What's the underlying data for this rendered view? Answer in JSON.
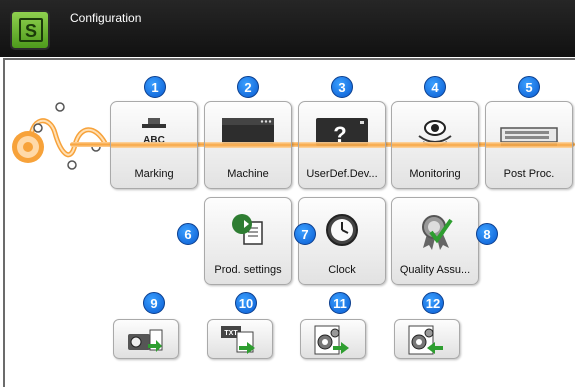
{
  "window": {
    "title": "Configuration",
    "logo_letter": "S"
  },
  "main_tiles": [
    {
      "number": "1",
      "label": "Marking",
      "icon": "marking-icon",
      "icon_text": "ABC"
    },
    {
      "number": "2",
      "label": "Machine",
      "icon": "machine-icon"
    },
    {
      "number": "3",
      "label": "UserDef.Dev...",
      "icon": "user-device-icon",
      "icon_text": "?"
    },
    {
      "number": "4",
      "label": "Monitoring",
      "icon": "eye-icon"
    },
    {
      "number": "5",
      "label": "Post Proc.",
      "icon": "post-process-icon"
    }
  ],
  "second_tiles": [
    {
      "number": "6",
      "label": "Prod. settings",
      "icon": "production-settings-icon"
    },
    {
      "number": "7",
      "label": "Clock",
      "icon": "clock-icon"
    },
    {
      "number": "8",
      "label": "Quality Assu...",
      "icon": "quality-badge-icon"
    }
  ],
  "small_buttons": [
    {
      "number": "9",
      "icon": "camera-export-icon"
    },
    {
      "number": "10",
      "icon": "txt-export-icon",
      "icon_text": "TXT"
    },
    {
      "number": "11",
      "icon": "settings-export-icon"
    },
    {
      "number": "12",
      "icon": "settings-import-icon"
    }
  ],
  "colors": {
    "accent_orange": "#f7a23a",
    "badge_blue": "#0a5bd1",
    "title_bar": "#1a1a1a"
  }
}
